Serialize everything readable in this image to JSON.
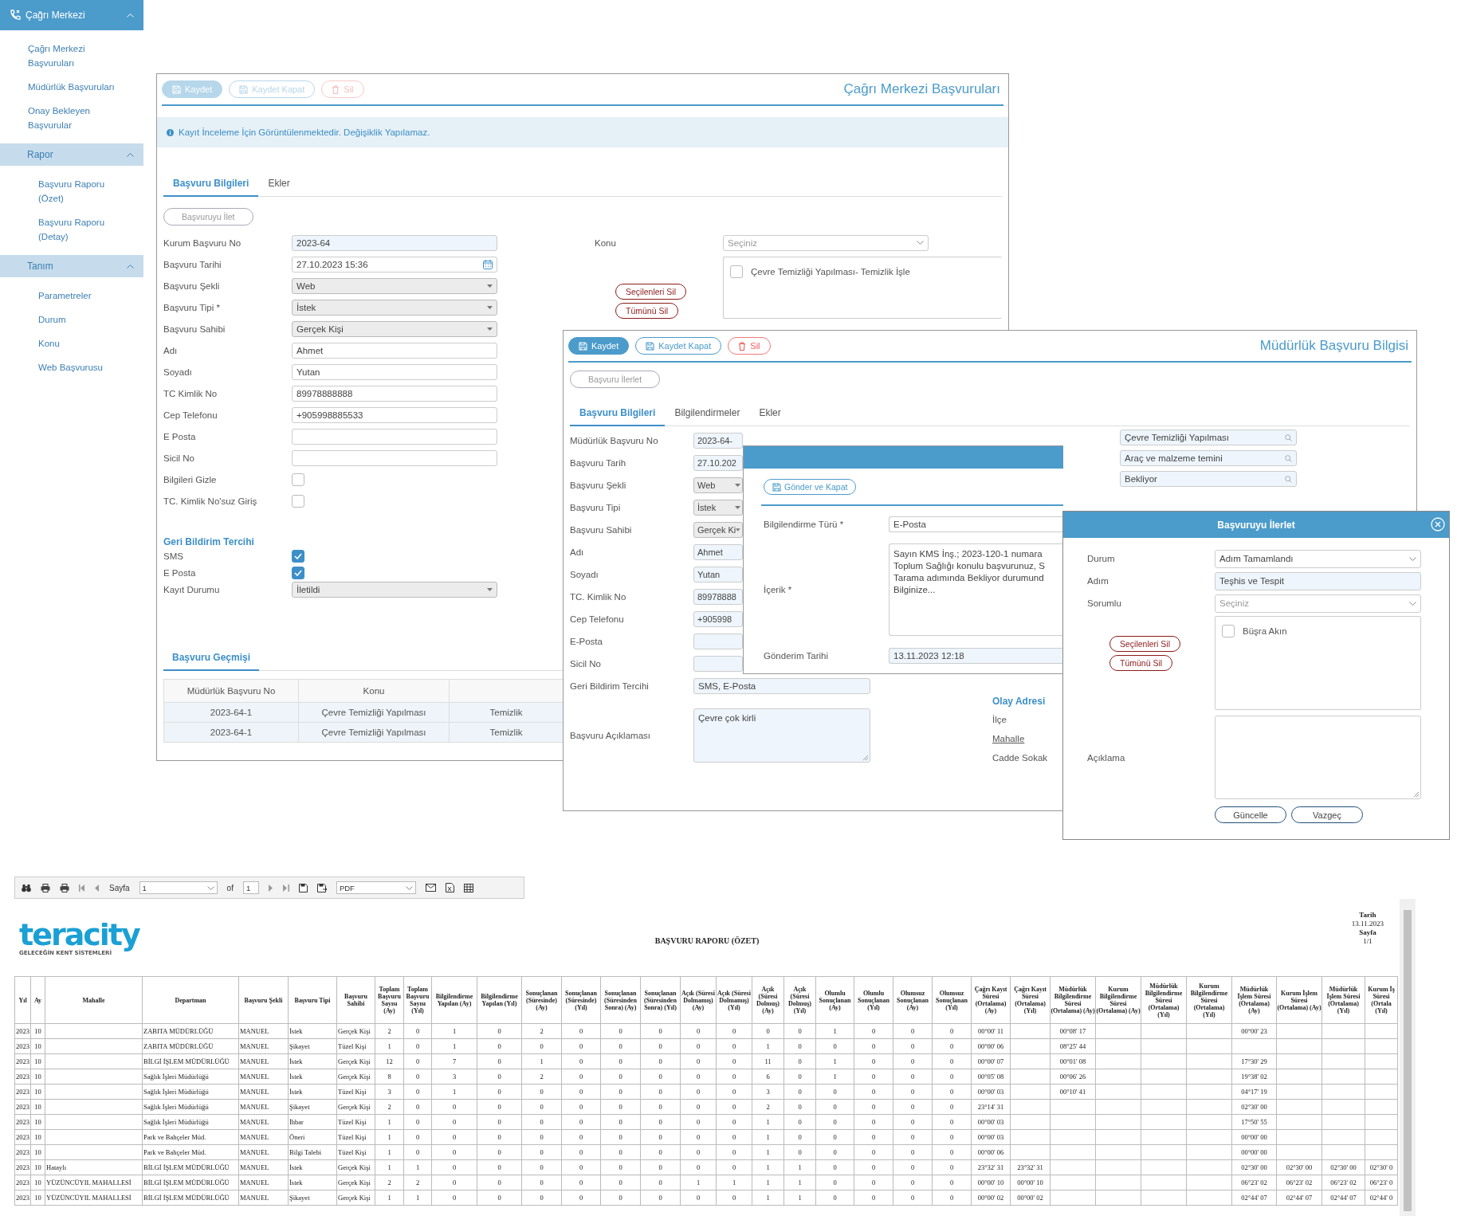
{
  "sidebar": {
    "sections": [
      {
        "title": "Çağrı Merkezi",
        "kind": "module",
        "expanded": true,
        "items": [
          "Çağrı Merkezi Başvuruları",
          "Müdürlük Başvuruları",
          "Onay Bekleyen Başvurular"
        ]
      },
      {
        "title": "Rapor",
        "kind": "group",
        "expanded": true,
        "items": [
          "Başvuru Raporu (Özet)",
          "Başvuru Raporu (Detay)"
        ]
      },
      {
        "title": "Tanım",
        "kind": "group",
        "expanded": true,
        "items": [
          "Parametreler",
          "Durum",
          "Konu",
          "Web Başvurusu"
        ]
      }
    ]
  },
  "case_window": {
    "title": "Çağrı Merkezi Başvuruları",
    "toolbar": [
      {
        "label": "Kaydet",
        "kind": "primary",
        "disabled": true
      },
      {
        "label": "Kaydet Kapat",
        "kind": "outline",
        "disabled": true
      },
      {
        "label": "Sil",
        "kind": "danger",
        "disabled": true
      }
    ],
    "notice": "Kayıt İnceleme İçin Görüntülenmektedir. Değişiklik Yapılamaz.",
    "tabs": [
      {
        "label": "Başvuru Bilgileri",
        "selected": true
      },
      {
        "label": "Ekler",
        "selected": false
      }
    ],
    "forward_button": "Başvuruyu İlet",
    "fields": [
      {
        "label": "Kurum Başvuru No",
        "kind": "readonly",
        "value": "2023-64"
      },
      {
        "label": "Başvuru Tarihi",
        "kind": "date",
        "value": "27.10.2023 15:36"
      },
      {
        "label": "Başvuru Şekli",
        "kind": "select",
        "value": "Web"
      },
      {
        "label": "Başvuru Tipi *",
        "kind": "select",
        "value": "İstek"
      },
      {
        "label": "Başvuru Sahibi",
        "kind": "select",
        "value": "Gerçek Kişi"
      },
      {
        "label": "Adı",
        "kind": "text",
        "value": "Ahmet"
      },
      {
        "label": "Soyadı",
        "kind": "text",
        "value": "Yutan"
      },
      {
        "label": "TC Kimlik No",
        "kind": "text",
        "value": "89978888888"
      },
      {
        "label": "Cep Telefonu",
        "kind": "text",
        "value": "+905998885533"
      },
      {
        "label": "E Posta",
        "kind": "text"
      },
      {
        "label": "Sicil No",
        "kind": "text"
      },
      {
        "label": "Bilgileri Gizle",
        "kind": "checkbox",
        "checked": false
      },
      {
        "label": "TC. Kimlik No'suz Giriş",
        "kind": "checkbox",
        "checked": false
      }
    ],
    "feedback": {
      "title": "Geri Bildirim Tercihi",
      "fields": [
        {
          "label": "SMS",
          "kind": "checkbox",
          "checked": true
        },
        {
          "label": "E Posta",
          "kind": "checkbox",
          "checked": true
        },
        {
          "label": "Kayıt Durumu",
          "kind": "select",
          "value": "İletildi"
        }
      ]
    },
    "subject": {
      "label": "Konu",
      "select": {
        "kind": "dropdown",
        "placeholder": "Seçiniz"
      },
      "options": [
        {
          "label": "Çevre Temizliği Yapılması- Temizlik İşle",
          "checked": false
        }
      ],
      "buttons": [
        "Seçilenleri Sil",
        "Tümünü Sil"
      ]
    },
    "history": {
      "title": "Başvuru Geçmişi",
      "columns": [
        "Müdürlük Başvuru No",
        "Konu"
      ],
      "rows": [
        [
          "2023-64-1",
          "Çevre Temizliği Yapılması",
          "Temizlik"
        ],
        [
          "2023-64-1",
          "Çevre Temizliği Yapılması",
          "Temizlik"
        ]
      ]
    }
  },
  "directorate_window": {
    "title": "Müdürlük Başvuru Bilgisi",
    "toolbar": [
      {
        "label": "Kaydet",
        "kind": "primary",
        "disabled": false
      },
      {
        "label": "Kaydet Kapat",
        "kind": "outline",
        "disabled": false
      },
      {
        "label": "Sil",
        "kind": "danger",
        "disabled": false
      }
    ],
    "forward_button": "Başvuru İlerlet",
    "tabs": [
      {
        "label": "Başvuru Bilgileri",
        "selected": true
      },
      {
        "label": "Bilgilendirmeler",
        "selected": false
      },
      {
        "label": "Ekler",
        "selected": false
      }
    ],
    "fields": [
      {
        "label": "Müdürlük Başvuru No",
        "kind": "readonly",
        "value": "2023-64-"
      },
      {
        "label": "Başvuru Tarih",
        "kind": "readonly",
        "value": "27.10.202"
      },
      {
        "label": "Başvuru Şekli",
        "kind": "select",
        "value": "Web"
      },
      {
        "label": "Başvuru Tipi",
        "kind": "select",
        "value": "İstek"
      },
      {
        "label": "Başvuru Sahibi",
        "kind": "select",
        "value": "Gerçek Ki"
      },
      {
        "label": "Adı",
        "kind": "readonly",
        "value": "Ahmet"
      },
      {
        "label": "Soyadı",
        "kind": "readonly",
        "value": "Yutan"
      },
      {
        "label": "TC. Kimlik No",
        "kind": "readonly",
        "value": "89978888"
      },
      {
        "label": "Cep Telefonu",
        "kind": "readonly",
        "value": "+905998"
      },
      {
        "label": "E-Posta",
        "kind": "readonly"
      },
      {
        "label": "Sicil No",
        "kind": "readonly"
      },
      {
        "label": "Geri Bildirim Tercihi",
        "kind": "readonly",
        "value": "SMS, E-Posta"
      },
      {
        "label": "Başvuru Açıklaması",
        "kind": "textarea",
        "value": "Çevre çok kirli"
      }
    ],
    "lookups": [
      {
        "kind": "lookup",
        "value": "Çevre Temizliği Yapılması"
      },
      {
        "kind": "lookup",
        "value": "Araç ve malzeme temini"
      },
      {
        "kind": "lookup",
        "value": "Bekliyor"
      }
    ],
    "address": {
      "title": "Olay Adresi",
      "fields": [
        {
          "label": "İlçe",
          "kind": "label"
        },
        {
          "label": "Mahalle",
          "kind": "link"
        },
        {
          "label": "Cadde Sokak",
          "kind": "label"
        }
      ]
    }
  },
  "notification_popup": {
    "button": "Gönder ve Kapat",
    "fields": [
      {
        "label": "Bilgilendirme Türü *",
        "kind": "text",
        "value": "E-Posta"
      },
      {
        "label": "İçerik *",
        "kind": "textarea",
        "lines": [
          "Sayın KMS İnş.; 2023-120-1 numara",
          "Toplum Sağlığı konulu başvurunuz, S",
          "Tarama adımında Bekliyor durumund",
          "Bilginize..."
        ]
      },
      {
        "label": "Gönderim Tarihi",
        "kind": "readonly",
        "value": "13.11.2023 12:18"
      }
    ]
  },
  "forward_dialog": {
    "title": "Başvuruyu İlerlet",
    "fields": [
      {
        "label": "Durum",
        "kind": "dropdown",
        "value": "Adım Tamamlandı"
      },
      {
        "label": "Adım",
        "kind": "readonly",
        "value": "Teşhis ve Tespit"
      },
      {
        "label": "Sorumlu",
        "kind": "dropdown",
        "placeholder": "Seçiniz"
      }
    ],
    "assignees": [
      {
        "label": "Büşra Akın",
        "checked": false
      }
    ],
    "list_buttons": [
      "Seçilenleri Sil",
      "Tümünü Sil"
    ],
    "note": {
      "label": "Açıklama",
      "kind": "textarea"
    },
    "buttons": [
      "Güncelle",
      "Vazgeç"
    ]
  },
  "report": {
    "toolbar": {
      "page_label": "Sayfa",
      "page": "1",
      "of_label": "of",
      "page_count": "1",
      "format": "PDF"
    },
    "logo": {
      "name": "teracity",
      "tagline": "GELECEĞİN KENT SİSTEMLERİ"
    },
    "title": "BAŞVURU RAPORU (ÖZET)",
    "meta": [
      {
        "label": "Tarih",
        "value": "13.11.2023"
      },
      {
        "label": "Sayfa",
        "value": "1/1"
      }
    ],
    "table": {
      "columns": [
        "Yıl",
        "Ay",
        "Mahalle",
        "Departman",
        "Başvuru Şekli",
        "Başvuru Tipi",
        "Başvuru Sahibi",
        "Toplam Başvuru Sayısı (Ay)",
        "Toplam Başvuru Sayısı (Yıl)",
        "Bilgilendirme Yapılan (Ay)",
        "Bilgilendirme Yapılan (Yıl)",
        "Sonuçlanan (Süresinde) (Ay)",
        "Sonuçlanan (Süresinde) (Yıl)",
        "Sonuçlanan (Süresinden Sonra) (Ay)",
        "Sonuçlanan (Süresinden Sonra) (Yıl)",
        "Açık (Süresi Dolmamış) (Ay)",
        "Açık (Süresi Dolmamış) (Yıl)",
        "Açık (Süresi Dolmuş) (Ay)",
        "Açık (Süresi Dolmuş) (Yıl)",
        "Olumlu Sonuçlanan (Ay)",
        "Olumlu Sonuçlanan (Yıl)",
        "Olumsuz Sonuçlanan (Ay)",
        "Olumsuz Sonuçlanan (Yıl)",
        "Çağrı Kayıt Süresi (Ortalama) (Ay)",
        "Çağrı Kayıt Süresi (Ortalama) (Yıl)",
        "Müdürlük Bilgilendirme Süresi (Ortalama) (Ay)",
        "Kurum Bilgilendirme Süresi (Ortalama) (Ay)",
        "Müdürlük Bilgilendirme Süresi (Ortalama) (Yıl)",
        "Kurum Bilgilendirme Süresi (Ortalama) (Yıl)",
        "Müdürlük İşlem Süresi (Ortalama) (Ay)",
        "Kurum İşlem Süresi (Ortalama) (Ay)",
        "Müdürlük İşlem Süresi (Ortalama) (Yıl)",
        "Kurum İş Süresi (Ortala (Yıl)"
      ],
      "rows": [
        [
          "2023",
          "10",
          null,
          "ZABITA MÜDÜRLÜĞÜ",
          "MANUEL",
          "İstek",
          "Gerçek Kişi",
          "2",
          "0",
          "1",
          "0",
          "2",
          "0",
          "0",
          "0",
          "0",
          "0",
          "0",
          "0",
          "1",
          "0",
          "0",
          "0",
          "00°00' 11",
          null,
          "00°08' 17",
          null,
          null,
          null,
          "00°00' 23",
          null,
          null,
          null
        ],
        [
          "2023",
          "10",
          null,
          "ZABITA MÜDÜRLÜĞÜ",
          "MANUEL",
          "Şikayet",
          "Tüzel Kişi",
          "1",
          "0",
          "1",
          "0",
          "0",
          "0",
          "0",
          "0",
          "0",
          "0",
          "1",
          "0",
          "0",
          "0",
          "0",
          "0",
          "00°00' 06",
          null,
          "08°25' 44",
          null,
          null,
          null,
          null,
          null,
          null,
          null
        ],
        [
          "2023",
          "10",
          null,
          "BİLGİ İŞLEM MÜDÜRLÜĞÜ",
          "MANUEL",
          "İstek",
          "Gerçek Kişi",
          "12",
          "0",
          "7",
          "0",
          "1",
          "0",
          "0",
          "0",
          "0",
          "0",
          "11",
          "0",
          "1",
          "0",
          "0",
          "0",
          "00°00' 07",
          null,
          "00°01' 08",
          null,
          null,
          null,
          "17°30' 29",
          null,
          null,
          null
        ],
        [
          "2023",
          "10",
          null,
          "Sağlık İşleri Müdürlüğü",
          "MANUEL",
          "İstek",
          "Gerçek Kişi",
          "8",
          "0",
          "3",
          "0",
          "2",
          "0",
          "0",
          "0",
          "0",
          "0",
          "6",
          "0",
          "1",
          "0",
          "0",
          "0",
          "00°05' 08",
          null,
          "00°06' 26",
          null,
          null,
          null,
          "19°38' 02",
          null,
          null,
          null
        ],
        [
          "2023",
          "10",
          null,
          "Sağlık İşleri Müdürlüğü",
          "MANUEL",
          "İstek",
          "Tüzel Kişi",
          "3",
          "0",
          "1",
          "0",
          "0",
          "0",
          "0",
          "0",
          "0",
          "0",
          "3",
          "0",
          "0",
          "0",
          "0",
          "0",
          "00°00' 03",
          null,
          "00°10' 41",
          null,
          null,
          null,
          "04°17' 19",
          null,
          null,
          null
        ],
        [
          "2023",
          "10",
          null,
          "Sağlık İşleri Müdürlüğü",
          "MANUEL",
          "Şikayet",
          "Gerçek Kişi",
          "2",
          "0",
          "0",
          "0",
          "0",
          "0",
          "0",
          "0",
          "0",
          "0",
          "2",
          "0",
          "0",
          "0",
          "0",
          "0",
          "23°14' 31",
          null,
          null,
          null,
          null,
          null,
          "02°30' 00",
          null,
          null,
          null
        ],
        [
          "2023",
          "10",
          null,
          "Sağlık İşleri Müdürlüğü",
          "MANUEL",
          "İhbar",
          "Tüzel Kişi",
          "1",
          "0",
          "0",
          "0",
          "0",
          "0",
          "0",
          "0",
          "0",
          "0",
          "1",
          "0",
          "0",
          "0",
          "0",
          "0",
          "00°00' 03",
          null,
          null,
          null,
          null,
          null,
          "17°50' 55",
          null,
          null,
          null
        ],
        [
          "2023",
          "10",
          null,
          "Park ve Bahçeler Müd.",
          "MANUEL",
          "Öneri",
          "Tüzel Kişi",
          "1",
          "0",
          "0",
          "0",
          "0",
          "0",
          "0",
          "0",
          "0",
          "0",
          "1",
          "0",
          "0",
          "0",
          "0",
          "0",
          "00°00' 03",
          null,
          null,
          null,
          null,
          null,
          "00°00' 00",
          null,
          null,
          null
        ],
        [
          "2023",
          "10",
          null,
          "Park ve Bahçeler Müd.",
          "MANUEL",
          "Bilgi Talebi",
          "Tüzel Kişi",
          "1",
          "0",
          "0",
          "0",
          "0",
          "0",
          "0",
          "0",
          "0",
          "0",
          "1",
          "0",
          "0",
          "0",
          "0",
          "0",
          "00°00' 06",
          null,
          null,
          null,
          null,
          null,
          "00°00' 00",
          null,
          null,
          null
        ],
        [
          "2023",
          "10",
          "Hataylı",
          "BİLGİ İŞLEM MÜDÜRLÜĞÜ",
          "MANUEL",
          "İstek",
          "Gerçek Kişi",
          "1",
          "1",
          "0",
          "0",
          "0",
          "0",
          "0",
          "0",
          "0",
          "0",
          "1",
          "1",
          "0",
          "0",
          "0",
          "0",
          "23°32' 31",
          "23°32' 31",
          null,
          null,
          null,
          null,
          "02°30' 00",
          "02°30' 00",
          "02°30' 00",
          "02°30' 0"
        ],
        [
          "2023",
          "10",
          "YÜZÜNCÜYIL MAHALLESİ",
          "BİLGİ İŞLEM MÜDÜRLÜĞÜ",
          "MANUEL",
          "İstek",
          "Gerçek Kişi",
          "2",
          "2",
          "0",
          "0",
          "0",
          "0",
          "0",
          "0",
          "1",
          "1",
          "1",
          "1",
          "0",
          "0",
          "0",
          "0",
          "00°00' 10",
          "00°00' 10",
          null,
          null,
          null,
          null,
          "06°23' 02",
          "06°23' 02",
          "06°23' 02",
          "06°23' 0"
        ],
        [
          "2023",
          "10",
          "YÜZÜNCÜYIL MAHALLESİ",
          "BİLGİ İŞLEM MÜDÜRLÜĞÜ",
          "MANUEL",
          "Şikayet",
          "Gerçek Kişi",
          "1",
          "1",
          "0",
          "0",
          "0",
          "0",
          "0",
          "0",
          "0",
          "0",
          "1",
          "1",
          "0",
          "0",
          "0",
          "0",
          "00°00' 02",
          "00°00' 02",
          null,
          null,
          null,
          null,
          "02°44' 07",
          "02°44' 07",
          "02°44' 07",
          "02°44' 0"
        ]
      ]
    }
  }
}
